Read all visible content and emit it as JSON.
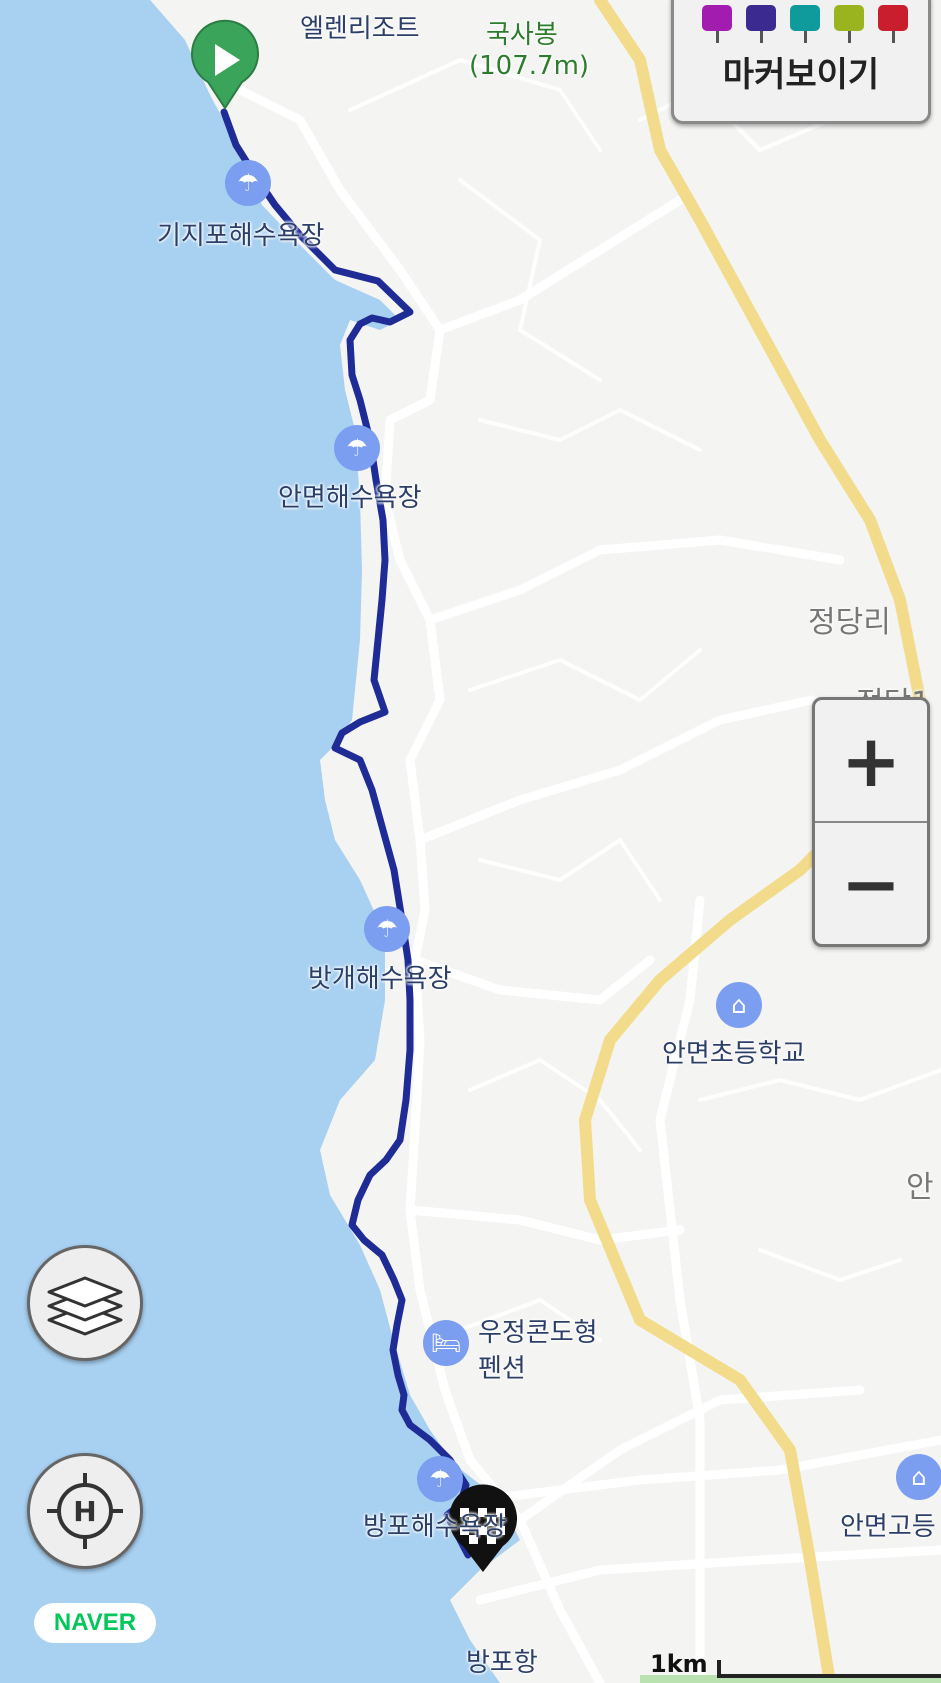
{
  "map": {
    "water_color": "#a8d0f0",
    "land_color": "#f4f4f2",
    "road_color": "#ffffff",
    "highway_color": "#f2dc8c",
    "route_color": "#1f2c96"
  },
  "labels": {
    "ellen_resort": "엘렌리조트",
    "guksabong": "국사봉",
    "guksabong_height": "(107.7m)",
    "gijipo_beach": "기지포해수욕장",
    "anmyeon_beach": "안면해수욕장",
    "jeongdang_ri": "정당리",
    "jeongdang_cut": "정당1",
    "batgae_beach": "밧개해수욕장",
    "anmyeon_elementary": "안면초등학교",
    "an_cut": "안",
    "ujeong_condo_line1": "우정콘도형",
    "ujeong_condo_line2": "펜션",
    "bangpo_beach": "방포해수욕장",
    "anmyeon_high": "안면고등",
    "bangpo_port": "방포항"
  },
  "controls": {
    "marker_toggle_label": "마커보이기",
    "marker_colors": [
      "#a21caf",
      "#3b2a8f",
      "#0f9b9b",
      "#9ab41f",
      "#c81e2d"
    ],
    "zoom_in": "+",
    "zoom_out": "−",
    "naver_logo": "NAVER",
    "scale": "1km"
  },
  "icons": {
    "start": "play-marker-icon",
    "finish": "checkered-flag-icon",
    "beach": "beach-umbrella-icon",
    "school": "school-icon",
    "lodging": "bed-icon",
    "layers": "layers-icon",
    "location": "locate-icon"
  }
}
